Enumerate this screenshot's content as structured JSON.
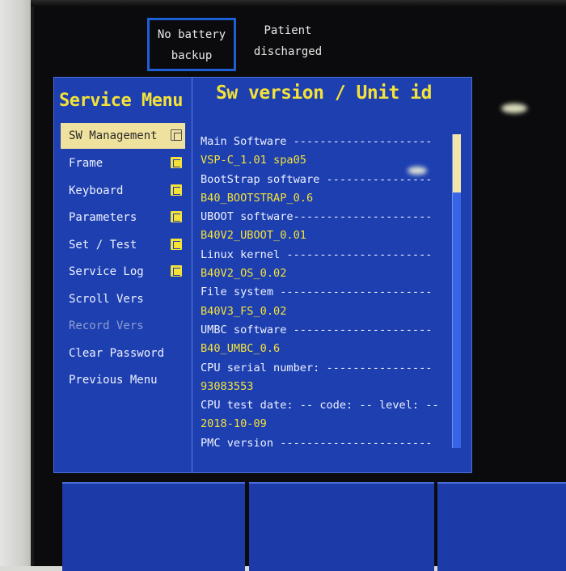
{
  "status": {
    "battery": [
      "No battery",
      "backup"
    ],
    "patient": [
      "Patient",
      "discharged"
    ]
  },
  "menu": {
    "title": "Service Menu",
    "items": [
      {
        "label": "SW Management",
        "selected": true,
        "submenu": true,
        "enabled": true
      },
      {
        "label": "Frame",
        "selected": false,
        "submenu": true,
        "enabled": true
      },
      {
        "label": "Keyboard",
        "selected": false,
        "submenu": true,
        "enabled": true
      },
      {
        "label": "Parameters",
        "selected": false,
        "submenu": true,
        "enabled": true
      },
      {
        "label": "Set / Test",
        "selected": false,
        "submenu": true,
        "enabled": true
      },
      {
        "label": "Service Log",
        "selected": false,
        "submenu": true,
        "enabled": true
      },
      {
        "label": "Scroll Vers",
        "selected": false,
        "submenu": false,
        "enabled": true
      },
      {
        "label": "Record Vers",
        "selected": false,
        "submenu": false,
        "enabled": false
      },
      {
        "label": "Clear Password",
        "selected": false,
        "submenu": false,
        "enabled": true
      },
      {
        "label": "Previous Menu",
        "selected": false,
        "submenu": false,
        "enabled": true
      }
    ]
  },
  "detail": {
    "title": "Sw version / Unit id",
    "rows": [
      {
        "text": "Main Software ---------------------",
        "kind": "label"
      },
      {
        "text": "VSP-C_1.01 spa05",
        "kind": "value"
      },
      {
        "text": "BootStrap software ----------------",
        "kind": "label"
      },
      {
        "text": "B40_BOOTSTRAP_0.6",
        "kind": "value"
      },
      {
        "text": "UBOOT software---------------------",
        "kind": "label"
      },
      {
        "text": "B40V2_UBOOT_0.01",
        "kind": "value"
      },
      {
        "text": "Linux kernel ----------------------",
        "kind": "label"
      },
      {
        "text": "B40V2_OS_0.02",
        "kind": "value"
      },
      {
        "text": "File system -----------------------",
        "kind": "label"
      },
      {
        "text": "B40V3_FS_0.02",
        "kind": "value"
      },
      {
        "text": "UMBC software ---------------------",
        "kind": "label"
      },
      {
        "text": "B40_UMBC_0.6",
        "kind": "value"
      },
      {
        "text": "CPU serial number: ----------------",
        "kind": "label"
      },
      {
        "text": "93083553",
        "kind": "value"
      },
      {
        "text": "CPU test date: -- code: -- level: --",
        "kind": "label"
      },
      {
        "text": "2018-10-09",
        "kind": "value"
      },
      {
        "text": "PMC version -----------------------",
        "kind": "label"
      }
    ]
  },
  "colors": {
    "panel": "#1d3fb0",
    "accent_yellow": "#f4e23a",
    "selection": "#efe29e",
    "battery_highlight": "#1f5fd6"
  },
  "icons": {
    "submenu": "submenu-icon"
  }
}
